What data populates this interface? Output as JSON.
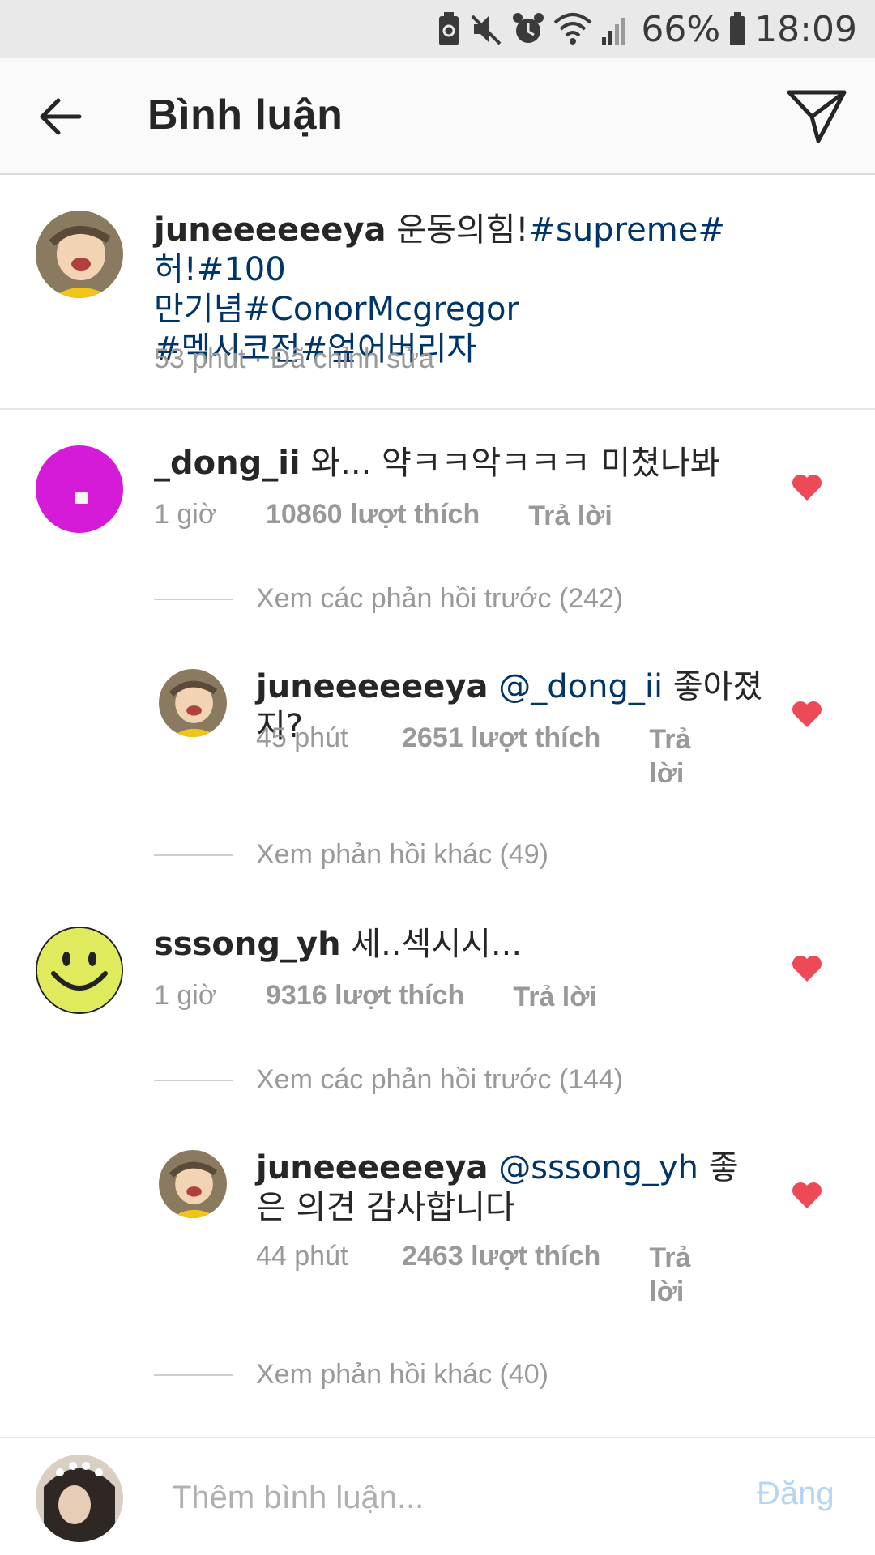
{
  "status_bar": {
    "battery": "66%",
    "time": "18:09"
  },
  "header": {
    "title": "Bình luận"
  },
  "caption": {
    "username": "juneeeeeeya",
    "text_prefix": " 운동의힘!",
    "tags_line1": "#supreme#허!#100",
    "tags_line2": "만기념#ConorMcgregor",
    "tags_line3": "#멕시코전#엎어버리자",
    "meta": "53 phút · Đã chỉnh sửa"
  },
  "comments": [
    {
      "username": "_dong_ii",
      "text": " 와... 약ㅋㅋ악ㅋㅋㅋ 미쳤나봐",
      "time": "1 giờ",
      "likes": "10860 lượt thích",
      "reply": "Trả lời",
      "view_more": "Xem các phản hồi trước (242)"
    },
    {
      "username": "juneeeeeeya",
      "mention": " @_dong_ii",
      "text": " 좋아졌지?",
      "time": "45 phút",
      "likes": "2651 lượt thích",
      "reply": "Trả lời",
      "view_more": "Xem phản hồi khác (49)"
    },
    {
      "username": "sssong_yh",
      "text": " 세..섹시시...",
      "time": "1 giờ",
      "likes": "9316 lượt thích",
      "reply": "Trả lời",
      "view_more": "Xem các phản hồi trước (144)"
    },
    {
      "username": "juneeeeeeya",
      "mention": " @sssong_yh",
      "text": " 좋은 의견 감사합니다",
      "time": "44 phút",
      "likes": "2463 lượt thích",
      "reply": "Trả lời",
      "view_more": "Xem phản hồi khác (40)"
    }
  ],
  "input": {
    "placeholder": "Thêm bình luận...",
    "post_label": "Đăng"
  },
  "colors": {
    "heart": "#ed4956",
    "hashtag": "#003569",
    "post_disabled": "#b4d6f4",
    "muted_text": "#999999"
  },
  "icons": {
    "back": "arrow-left-icon",
    "send": "paper-plane-icon",
    "like": "heart-filled-icon"
  }
}
